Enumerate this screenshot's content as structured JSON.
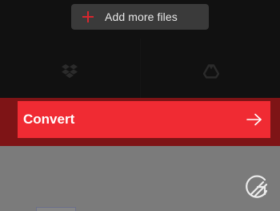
{
  "upload": {
    "add_files_label": "Add more files",
    "add_icon": "plus-icon",
    "sources": [
      {
        "name": "Dropbox",
        "icon": "dropbox-icon"
      },
      {
        "name": "Google Drive",
        "icon": "google-drive-icon"
      }
    ]
  },
  "convert": {
    "label": "Convert",
    "icon": "arrow-right-icon"
  },
  "brand": {
    "logo_icon": "app-logo-icon"
  },
  "colors": {
    "accent": "#f02b33",
    "band": "#7e1416",
    "top_background": "#111111",
    "lower_background": "#7b7b7b",
    "add_button": "#3a3a3a",
    "plus": "#d8262e"
  }
}
